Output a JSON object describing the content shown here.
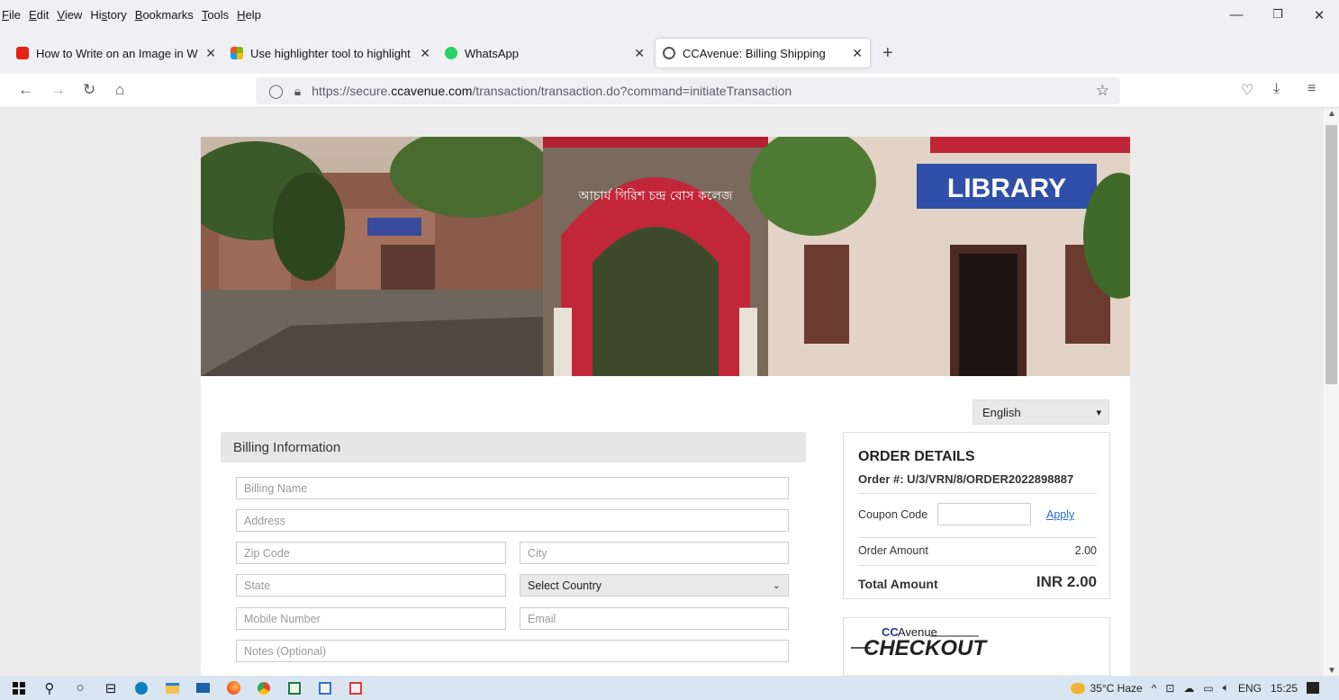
{
  "menu": {
    "items": [
      "File",
      "Edit",
      "View",
      "History",
      "Bookmarks",
      "Tools",
      "Help"
    ],
    "underlines": [
      "F",
      "E",
      "V",
      "s",
      "B",
      "T",
      "H"
    ]
  },
  "window": {
    "minimize": "—",
    "restore": "❐",
    "close": "✕"
  },
  "tabs": [
    {
      "label": "How to Write on an Image in W",
      "icon": "youtube-icon",
      "color": "#e62117"
    },
    {
      "label": "Use highlighter tool to highlight",
      "icon": "microsoft-icon",
      "color": "#f4b400"
    },
    {
      "label": "WhatsApp",
      "icon": "whatsapp-icon",
      "color": "#25d366"
    },
    {
      "label": "CCAvenue: Billing Shipping",
      "icon": "globe-icon",
      "color": "#555555"
    }
  ],
  "newtab": "+",
  "nav": {
    "url_prefix": "https://secure.",
    "url_domain": "ccavenue.com",
    "url_path": "/transaction/transaction.do?command=initiateTransaction"
  },
  "form": {
    "language": "English",
    "billing_title": "Billing Information",
    "billing_name": "Billing Name",
    "address": "Address",
    "zip": "Zip Code",
    "city": "City",
    "state": "State",
    "country": "Select Country",
    "mobile": "Mobile Number",
    "email": "Email",
    "notes": "Notes (Optional)"
  },
  "order": {
    "title": "ORDER DETAILS",
    "order_no": "Order #:  U/3/VRN/8/ORDER2022898887",
    "coupon_label": "Coupon Code",
    "apply": "Apply",
    "amount_label": "Order Amount",
    "amount": "2.00",
    "total_label": "Total Amount",
    "total": "INR 2.00"
  },
  "banner": {
    "library_sign": "LIBRARY",
    "arch_text": "আচার্য গিরিশ চন্দ্র বোস কলেজ"
  },
  "checkout_logo": {
    "cc": "CC",
    "avenue": "Avenue",
    "checkout": "CHECKOUT"
  },
  "tray": {
    "weather": "35°C  Haze",
    "lang": "ENG",
    "time": "15:25"
  }
}
